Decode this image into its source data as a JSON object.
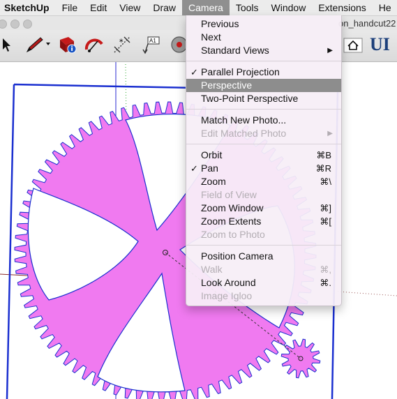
{
  "menubar": {
    "app": "SketchUp",
    "items": [
      "File",
      "Edit",
      "View",
      "Draw",
      "Camera",
      "Tools",
      "Window",
      "Extensions",
      "He"
    ]
  },
  "window": {
    "title_fragment": "on_handcut22"
  },
  "toolbar": {
    "icons": [
      "select-arrow-icon",
      "pencil-icon",
      "model-info-icon",
      "protractor-icon",
      "dimension-icon",
      "text-label-icon",
      "camera-orbit-icon"
    ],
    "ui_logo": "UI"
  },
  "camera_menu": {
    "items": [
      {
        "label": "Previous"
      },
      {
        "label": "Next"
      },
      {
        "label": "Standard Views",
        "submenu": true
      },
      {
        "label": "Parallel Projection",
        "checked": true
      },
      {
        "label": "Perspective",
        "highlighted": true
      },
      {
        "label": "Two-Point Perspective"
      },
      {
        "label": "Match New Photo..."
      },
      {
        "label": "Edit Matched Photo",
        "disabled": true,
        "submenu": true
      },
      {
        "label": "Orbit",
        "shortcut": "⌘B"
      },
      {
        "label": "Pan",
        "shortcut": "⌘R",
        "checked": true
      },
      {
        "label": "Zoom",
        "shortcut": "⌘\\"
      },
      {
        "label": "Field of View",
        "disabled": true
      },
      {
        "label": "Zoom Window",
        "shortcut": "⌘]"
      },
      {
        "label": "Zoom Extents",
        "shortcut": "⌘["
      },
      {
        "label": "Zoom to Photo",
        "disabled": true
      },
      {
        "label": "Position Camera"
      },
      {
        "label": "Walk",
        "shortcut": "⌘,",
        "disabled": true
      },
      {
        "label": "Look Around",
        "shortcut": "⌘."
      },
      {
        "label": "Image Igloo",
        "disabled": true
      }
    ]
  },
  "colors": {
    "gear_fill": "#f07af0",
    "outline": "#1a2fd0",
    "menu_highlight": "#8d8d8d"
  }
}
